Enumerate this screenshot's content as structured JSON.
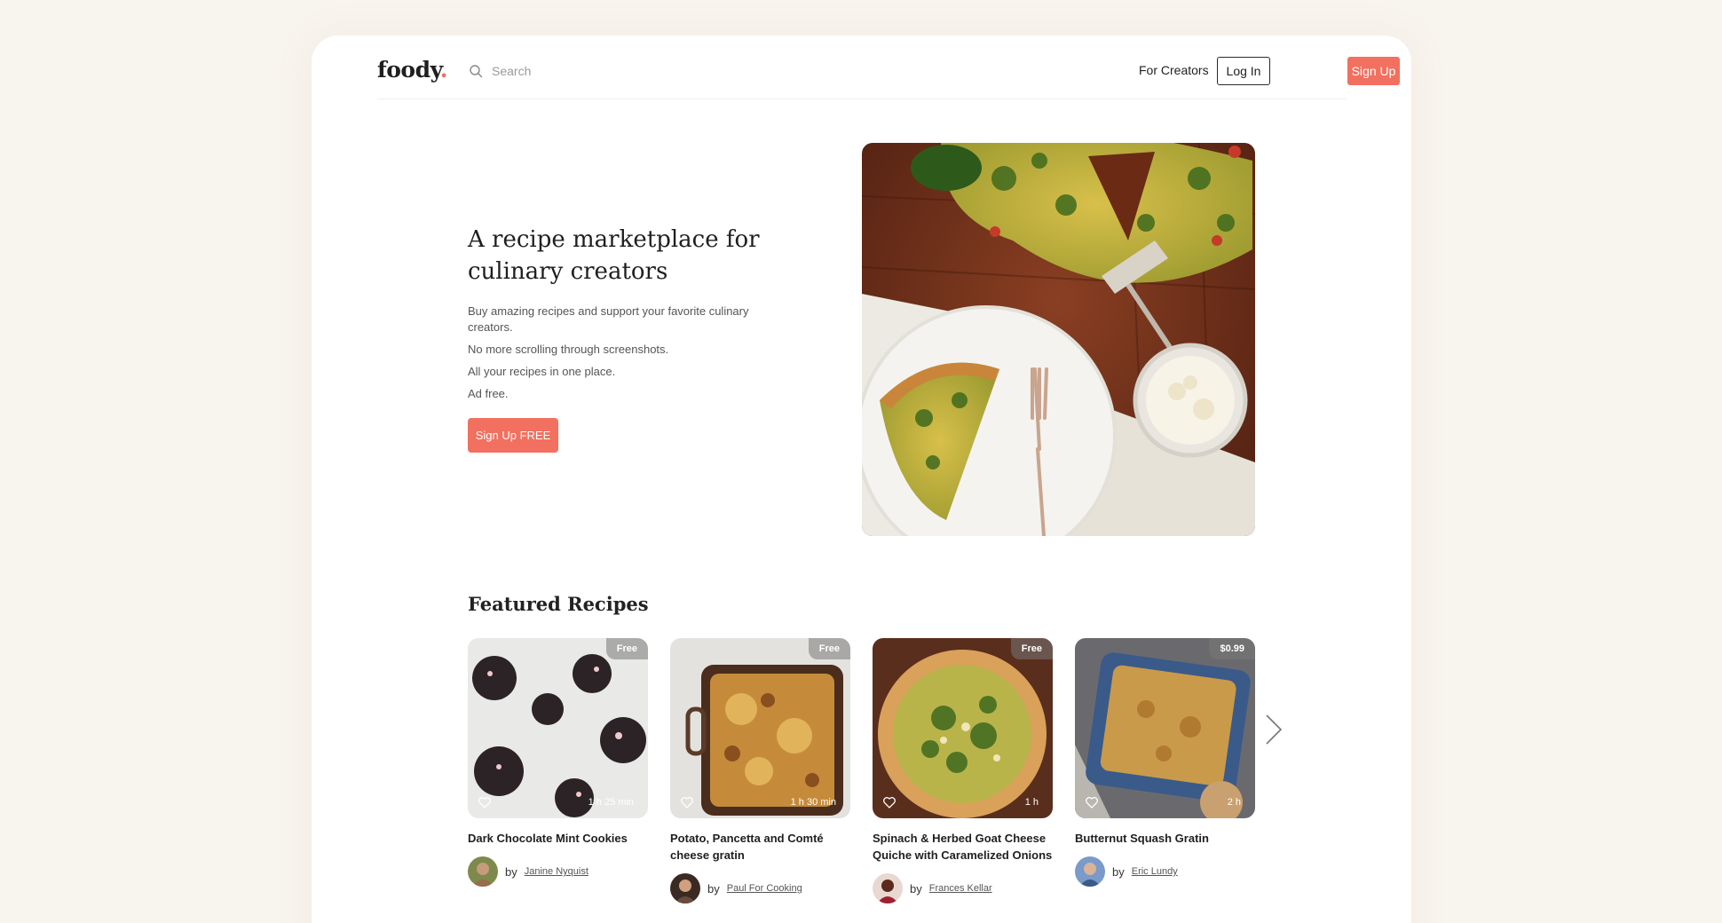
{
  "header": {
    "logo": "foody",
    "logo_dot": ".",
    "search_placeholder": "Search",
    "for_creators": "For Creators",
    "login": "Log In",
    "signup": "Sign Up"
  },
  "hero": {
    "title": "A recipe marketplace for culinary creators",
    "lines": [
      "Buy amazing recipes and support your favorite culinary creators.",
      "No more scrolling through screenshots.",
      "All your recipes in one place.",
      "Ad free."
    ],
    "cta": "Sign Up FREE"
  },
  "featured": {
    "title": "Featured Recipes",
    "by_label": "by",
    "recipes": [
      {
        "title": "Dark Chocolate Mint Cookies",
        "price": "Free",
        "time": "1 h 25 min",
        "author": "Janine Nyquist"
      },
      {
        "title": "Potato, Pancetta and Comté cheese gratin",
        "price": "Free",
        "time": "1 h 30 min",
        "author": "Paul For Cooking"
      },
      {
        "title": "Spinach & Herbed Goat Cheese Quiche with Caramelized Onions",
        "price": "Free",
        "time": "1 h",
        "author": "Frances Kellar"
      },
      {
        "title": "Butternut Squash Gratin",
        "price": "$0.99",
        "time": "2 h",
        "author": "Eric Lundy"
      }
    ]
  },
  "colors": {
    "accent": "#f2705f",
    "background": "#f8f4ee"
  },
  "icons": {
    "search": "search-icon",
    "heart": "heart-icon",
    "next": "chevron-right-icon"
  }
}
